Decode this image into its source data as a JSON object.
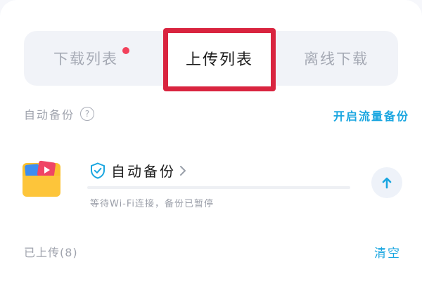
{
  "tabs": {
    "download": "下载列表",
    "upload": "上传列表",
    "offline": "离线下载"
  },
  "auto_backup_section": {
    "title": "自动备份",
    "help_icon": "?",
    "enable_traffic": "开启流量备份"
  },
  "backup_item": {
    "title": "自动备份",
    "status": "等待Wi-Fi连接，备份已暂停",
    "progress_fraction": 0
  },
  "uploaded_section": {
    "title": "已上传(8)",
    "clear": "清空"
  },
  "colors": {
    "accent": "#1aa6e0",
    "highlight": "#d9243f",
    "badge": "#f2415b"
  },
  "icons": [
    "help-icon",
    "shield-check-icon",
    "chevron-right-icon",
    "folder-media-icon",
    "arrow-up-icon"
  ]
}
